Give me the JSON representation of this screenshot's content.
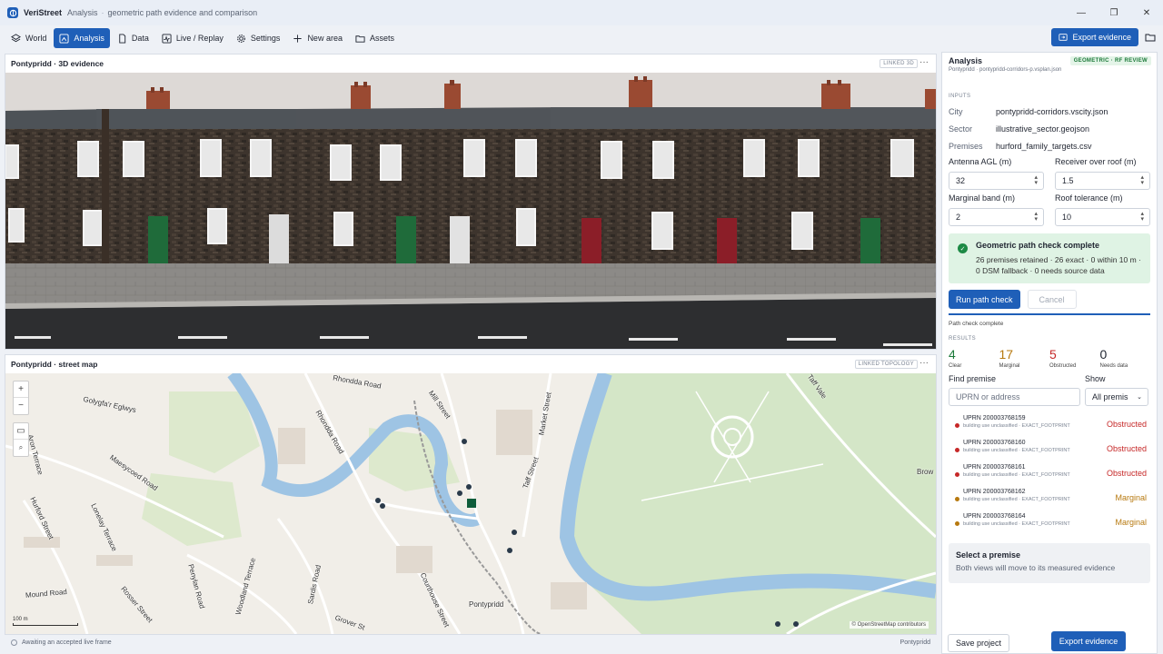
{
  "titlebar": {
    "app_name": "VeriStreet",
    "crumbs": [
      "Analysis",
      "geometric path evidence and comparison"
    ]
  },
  "toolbar": {
    "items": [
      {
        "label": "World",
        "icon": "layers-icon"
      },
      {
        "label": "Analysis",
        "icon": "chart-icon"
      },
      {
        "label": "Data",
        "icon": "file-icon"
      },
      {
        "label": "Live / Replay",
        "icon": "pulse-icon"
      },
      {
        "label": "Settings",
        "icon": "gear-icon"
      },
      {
        "label": "New area",
        "icon": "plus-icon"
      },
      {
        "label": "Assets",
        "icon": "folder-icon"
      }
    ],
    "active": "Analysis",
    "export_label": "Export evidence"
  },
  "view3d": {
    "title": "Pontypridd · 3D evidence",
    "linked_label": "LINKED 3D"
  },
  "map": {
    "title": "Pontypridd · street map",
    "linked_label": "LINKED TOPOLOGY",
    "scale_label": "100 m",
    "attribution": "© OpenStreetMap contributors",
    "labels": [
      "Rhondda Road",
      "Golygfa'r Eglwys",
      "Mill Street",
      "Market Street",
      "Rhondda Road",
      "Maesycoed Road",
      "Aron Terrace",
      "Hurford Street",
      "Lonelay Terrace",
      "Taff Street",
      "Penylan Road",
      "Sardis Road",
      "Woodland Terrace",
      "Mound Road",
      "Rosser Street",
      "Courthouse Street",
      "Pontypridd",
      "Grover St",
      "Brow",
      "Taff Vale"
    ]
  },
  "statusbar": {
    "left": "Awaiting an accepted live frame",
    "right": "Pontypridd"
  },
  "analysis": {
    "title": "Analysis",
    "subtitle": "Pontypridd · pontypridd-corridors-p.vsplan.json",
    "badge": "GEOMETRIC · RF REVIEW",
    "inputs_label": "INPUTS",
    "inputs": [
      {
        "k": "City",
        "v": "pontypridd-corridors.vscity.json"
      },
      {
        "k": "Sector",
        "v": "illustrative_sector.geojson"
      },
      {
        "k": "Premises",
        "v": "hurford_family_targets.csv"
      }
    ],
    "fields": [
      {
        "label": "Antenna AGL (m)",
        "value": "32"
      },
      {
        "label": "Receiver over roof (m)",
        "value": "1.5"
      },
      {
        "label": "Marginal band (m)",
        "value": "2"
      },
      {
        "label": "Roof tolerance (m)",
        "value": "10"
      }
    ],
    "result_box": {
      "title": "Geometric path check complete",
      "detail": "26 premises retained · 26 exact · 0 within 10 m · 0 DSM fallback · 0 needs source data"
    },
    "run_label": "Run path check",
    "cancel_label": "Cancel",
    "progress_fraction": 1.0,
    "progress_text": "Path check complete",
    "results_label": "RESULTS",
    "stats": [
      {
        "n": "4",
        "l": "Clear",
        "color": "#1d7a3a"
      },
      {
        "n": "17",
        "l": "Marginal",
        "color": "#b7790f"
      },
      {
        "n": "5",
        "l": "Obstructed",
        "color": "#c62828"
      },
      {
        "n": "0",
        "l": "Needs data",
        "color": "#1f2430"
      }
    ],
    "find_label": "Find premise",
    "show_label": "Show",
    "search_placeholder": "UPRN or address",
    "show_value": "All premis",
    "premises": [
      {
        "id": "UPRN 200003768159",
        "meta": "building use unclassified · EXACT_FOOTPRINT",
        "status": "Obstructed",
        "color": "#c62828"
      },
      {
        "id": "UPRN 200003768160",
        "meta": "building use unclassified · EXACT_FOOTPRINT",
        "status": "Obstructed",
        "color": "#c62828"
      },
      {
        "id": "UPRN 200003768161",
        "meta": "building use unclassified · EXACT_FOOTPRINT",
        "status": "Obstructed",
        "color": "#c62828"
      },
      {
        "id": "UPRN 200003768162",
        "meta": "building use unclassified · EXACT_FOOTPRINT",
        "status": "Marginal",
        "color": "#b7790f"
      },
      {
        "id": "UPRN 200003768164",
        "meta": "building use unclassified · EXACT_FOOTPRINT",
        "status": "Marginal",
        "color": "#b7790f"
      }
    ],
    "hint_title": "Select a premise",
    "hint_detail": "Both views will move to its measured evidence",
    "save_label": "Save project",
    "export_label": "Export evidence"
  }
}
